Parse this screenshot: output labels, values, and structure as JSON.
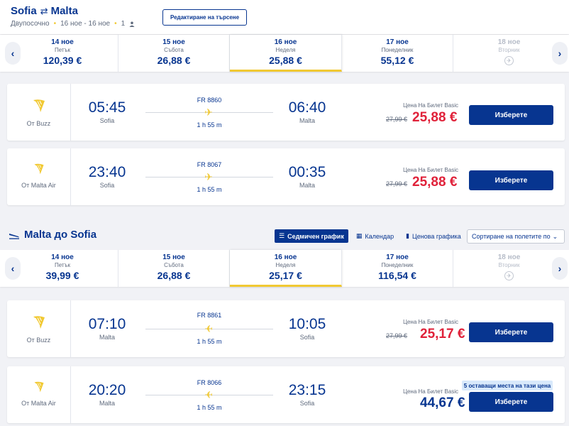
{
  "header": {
    "origin": "Sofia",
    "destination": "Malta",
    "swap_glyph": "⇄",
    "trip_type": "Двупосочно",
    "dates": "16 ное - 16 ное",
    "passengers": "1",
    "edit_button": "Редактиране на търсене"
  },
  "outbound": {
    "dates": [
      {
        "day": "14 ное",
        "weekday": "Петък",
        "price": "120,39 €"
      },
      {
        "day": "15 ное",
        "weekday": "Събота",
        "price": "26,88 €"
      },
      {
        "day": "16 ное",
        "weekday": "Неделя",
        "price": "25,88 €"
      },
      {
        "day": "17 ное",
        "weekday": "Понеделник",
        "price": "55,12 €"
      },
      {
        "day": "18 ное",
        "weekday": "Вторник",
        "price": ""
      }
    ],
    "flights": [
      {
        "operator": "От Buzz",
        "dep_time": "05:45",
        "dep_city": "Sofia",
        "flight_no": "FR 8860",
        "duration": "1 h 55 m",
        "arr_time": "06:40",
        "arr_city": "Malta",
        "fare_label": "Цена На Билет Basic",
        "old_price": "27,99 €",
        "price": "25,88 €",
        "button": "Изберете"
      },
      {
        "operator": "От Malta Air",
        "dep_time": "23:40",
        "dep_city": "Sofia",
        "flight_no": "FR 8067",
        "duration": "1 h 55 m",
        "arr_time": "00:35",
        "arr_city": "Malta",
        "fare_label": "Цена На Билет Basic",
        "old_price": "27,99 €",
        "price": "25,88 €",
        "button": "Изберете"
      }
    ]
  },
  "return": {
    "title": "Malta до Sofia",
    "tabs": [
      "Седмичен график",
      "Календар",
      "Ценова графика"
    ],
    "sort": "Сортиране на полетите по",
    "dates": [
      {
        "day": "14 ное",
        "weekday": "Петък",
        "price": "39,99 €"
      },
      {
        "day": "15 ное",
        "weekday": "Събота",
        "price": "26,88 €"
      },
      {
        "day": "16 ное",
        "weekday": "Неделя",
        "price": "25,17 €"
      },
      {
        "day": "17 ное",
        "weekday": "Понеделник",
        "price": "116,54 €"
      },
      {
        "day": "18 ное",
        "weekday": "Вторник",
        "price": ""
      }
    ],
    "flights": [
      {
        "operator": "От Buzz",
        "dep_time": "07:10",
        "dep_city": "Malta",
        "flight_no": "FR 8861",
        "duration": "1 h 55 m",
        "arr_time": "10:05",
        "arr_city": "Sofia",
        "fare_label": "Цена На Билет Basic",
        "old_price": "27,99 €",
        "price": "25,17 €",
        "button": "Изберете"
      },
      {
        "operator": "От Malta Air",
        "dep_time": "20:20",
        "dep_city": "Malta",
        "flight_no": "FR 8066",
        "duration": "1 h 55 m",
        "arr_time": "23:15",
        "arr_city": "Sofia",
        "fare_label": "Цена На Билет Basic",
        "old_price": "",
        "price": "44,67 €",
        "seats_badge": "5 оставащи места на тази цена",
        "button": "Изберете"
      }
    ]
  },
  "colors": {
    "brand_blue": "#073590",
    "accent_yellow": "#f1c933",
    "price_red": "#e0223a"
  }
}
